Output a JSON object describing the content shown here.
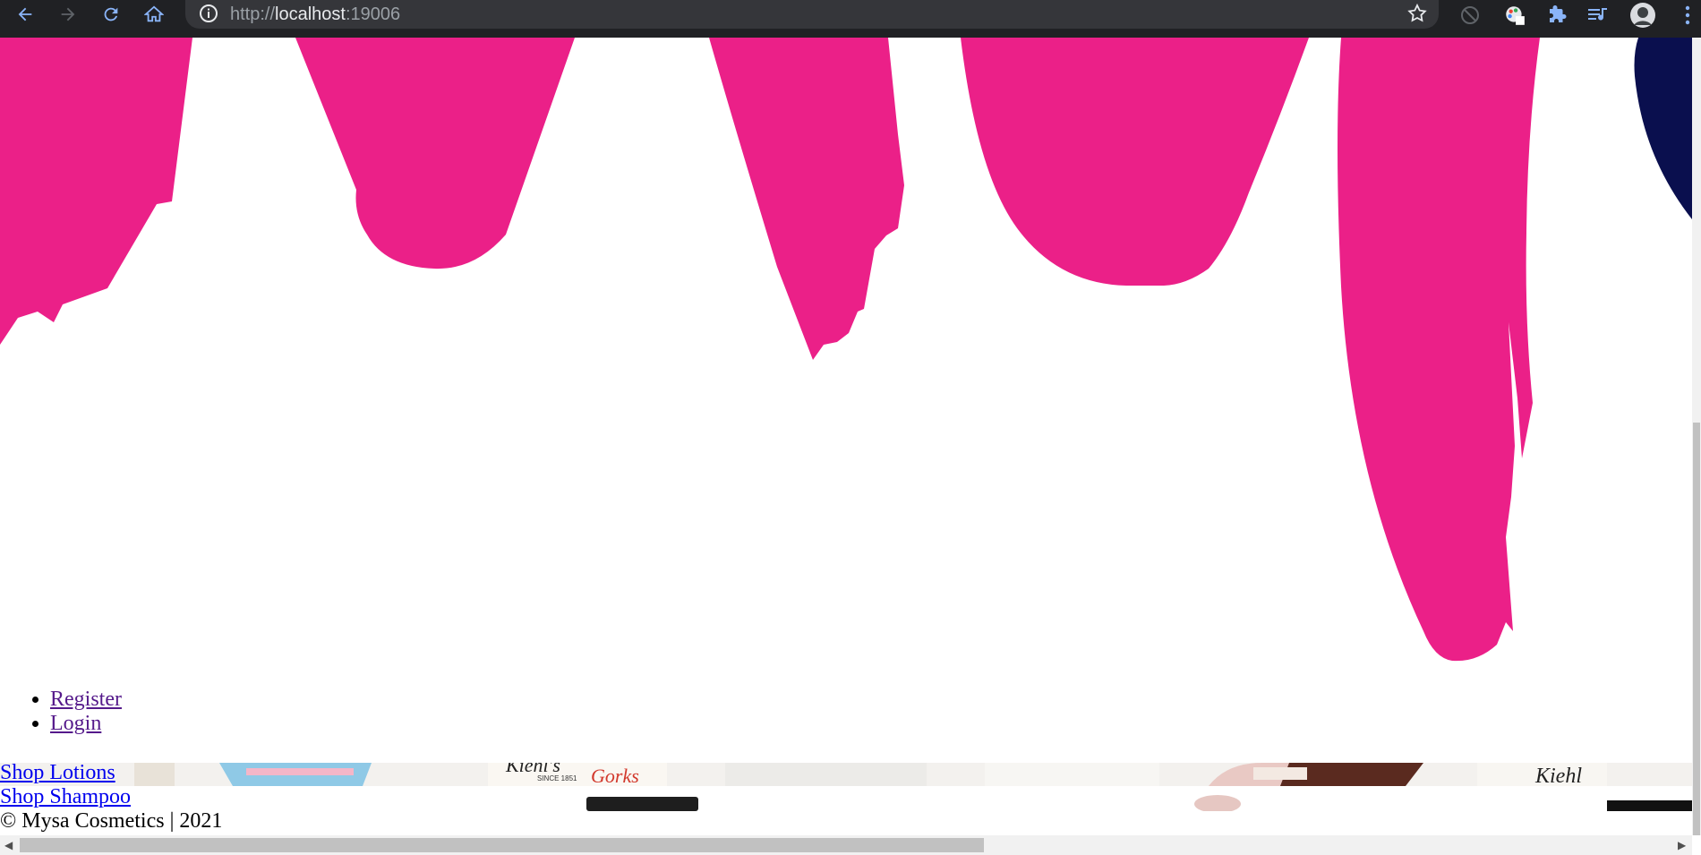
{
  "browser": {
    "url_scheme": "http://",
    "url_host": "localhost",
    "url_port": ":19006"
  },
  "colors": {
    "brush_pink": "#EB2088",
    "navy": "#0A0F4E",
    "chrome_bg": "#202124",
    "link_visited": "#551A8B",
    "link": "#0000EE"
  },
  "nav": {
    "items": [
      {
        "label": "Register"
      },
      {
        "label": "Login"
      }
    ]
  },
  "shop": {
    "lotions_label": "Shop Lotions",
    "shampoo_label": "Shop Shampoo"
  },
  "banner": {
    "brand_text_1": "Kiehl's",
    "since_text": "SINCE 1851",
    "product_text": "Gorks",
    "brand_text_2": "Kiehl"
  },
  "footer": {
    "copyright": "© Mysa Cosmetics | 2021"
  }
}
